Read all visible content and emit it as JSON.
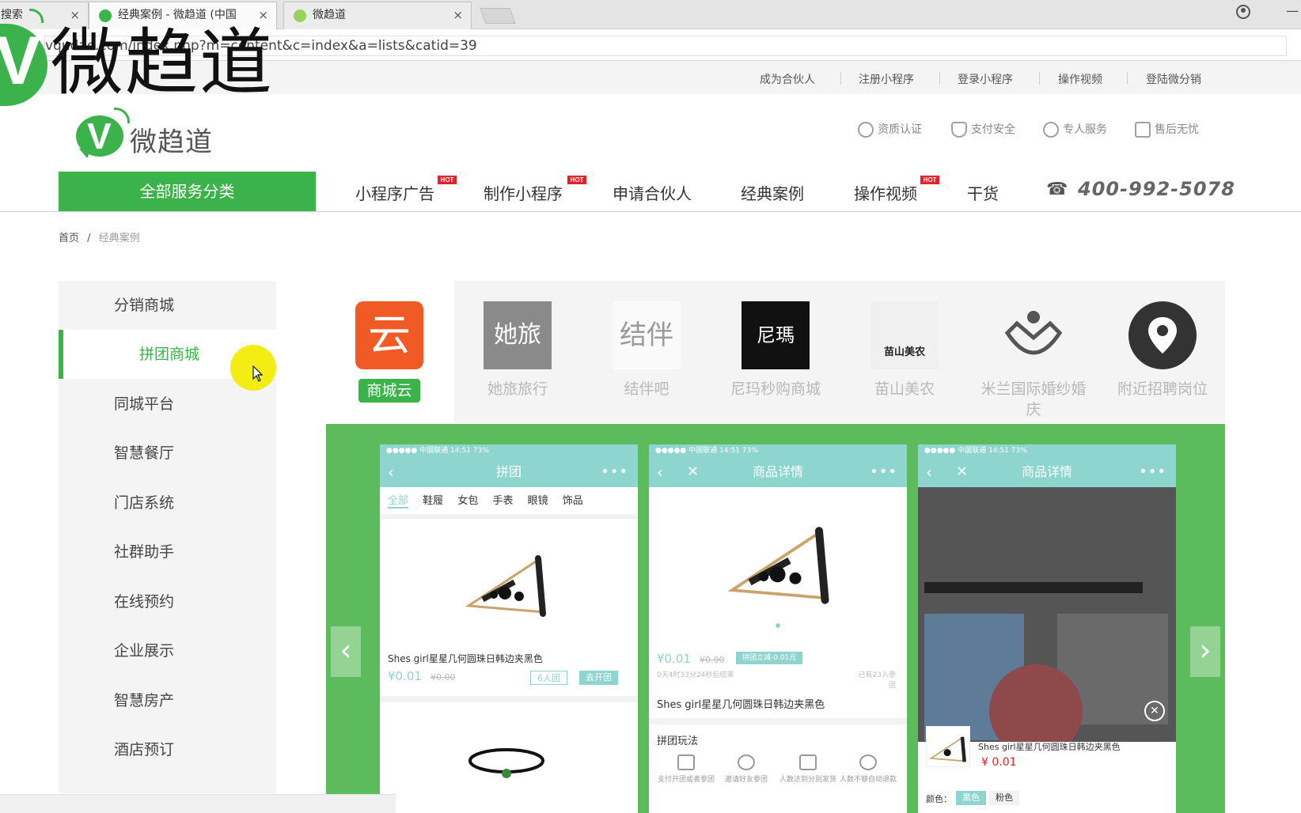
{
  "browser": {
    "tabs": [
      {
        "title": "搜索",
        "close": "×"
      },
      {
        "title": "经典案例 - 微趋道 (中国",
        "close": "×"
      },
      {
        "title": "微趋道",
        "close": "×"
      }
    ],
    "address": "vqudao.com/index.php?m=content&c=index&a=lists&catid=39",
    "watermark": "微趋道",
    "minimize": "—"
  },
  "site": {
    "toplinks": [
      "成为合伙人",
      "注册小程序",
      "登录小程序",
      "操作视频",
      "登陆微分销"
    ],
    "logo_name": "微趋道",
    "assurances": [
      "资质认证",
      "支付安全",
      "专人服务",
      "售后无忧"
    ],
    "all_categories": "全部服务分类",
    "nav": [
      {
        "label": "小程序广告",
        "hot": "HOT"
      },
      {
        "label": "制作小程序",
        "hot": "HOT"
      },
      {
        "label": "申请合伙人",
        "hot": ""
      },
      {
        "label": "经典案例",
        "hot": ""
      },
      {
        "label": "操作视频",
        "hot": "HOT"
      },
      {
        "label": "干货",
        "hot": ""
      }
    ],
    "phone": "400-992-5078",
    "breadcrumb": {
      "home": "首页",
      "sep": "/",
      "current": "经典案例"
    },
    "sidebar": [
      "分销商城",
      "拼团商城",
      "同城平台",
      "智慧餐厅",
      "门店系统",
      "社群助手",
      "在线预约",
      "企业展示",
      "智慧房产",
      "酒店预订"
    ],
    "sidebar_active": "拼团商城",
    "cases": [
      "商城云",
      "她旅旅行",
      "结伴吧",
      "尼玛秒购商城",
      "苗山美农",
      "米兰国际婚纱婚庆",
      "附近招聘岗位"
    ],
    "case_badges": {
      "yun": "云",
      "tarvel": "她旅",
      "jieban": "结伴",
      "nima": "尼瑪",
      "miaoshan": "苗山美农"
    },
    "showcase": {
      "prev": "‹",
      "next": "›",
      "phone1": {
        "status": "●●●●● 中国联通   14:51   73%",
        "title": "拼团",
        "tabs": [
          "全部",
          "鞋履",
          "女包",
          "手表",
          "眼镜",
          "饰品"
        ],
        "product": "Shes girl星星几何圆珠日韩边夹黑色",
        "price": "¥0.01",
        "old_price": "¥0.00",
        "group_btn": "6人团",
        "open_btn": "去开团"
      },
      "phone2": {
        "status": "●●●●● 中国联通   14:51   73%",
        "title": "商品详情",
        "price": "¥0.01",
        "old_price": "¥0.00",
        "tag": "拼团立减-0.01元",
        "countdown": "0天4时33分24秒后结束",
        "joined": "已有23人参团",
        "product": "Shes girl星星几何圆珠日韩边夹黑色",
        "rules_title": "拼团玩法",
        "rules": [
          "支付开团或者参团",
          "邀请好友参团",
          "人数达到分别发货",
          "人数不够自动退款"
        ]
      },
      "phone3": {
        "status": "●●●●● 中国联通   14:51   73%",
        "title": "商品详情",
        "product": "Shes girl星星几何圆珠日韩边夹黑色",
        "price": "¥ 0.01",
        "color_label": "颜色：",
        "colors": [
          "黑色",
          "粉色"
        ]
      }
    }
  },
  "colors": {
    "brand": "#3cb34a",
    "teal": "#8fd5cf",
    "hot": "#e0242a"
  }
}
